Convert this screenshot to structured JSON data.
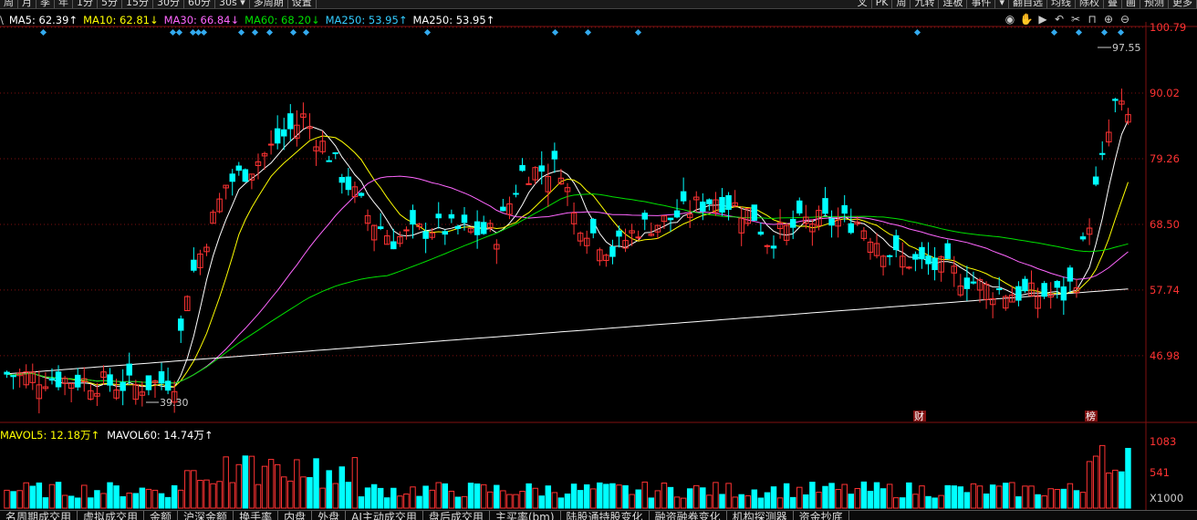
{
  "toolbar": {
    "left_buttons": [
      "周",
      "月",
      "季",
      "年",
      "1分",
      "5分",
      "15分",
      "30分",
      "60分",
      "30s ▾",
      "多周期",
      "设置"
    ],
    "right_buttons": [
      "叉",
      "PK",
      "周",
      "九转",
      "连板",
      "事件",
      "▾",
      "翻自选",
      "均线",
      "除权",
      "叠",
      "画",
      "预测",
      "更多"
    ]
  },
  "legend": {
    "prefix": "\\",
    "items": [
      {
        "text": "MA5: 62.39↑",
        "color": "#ffffff"
      },
      {
        "text": "MA10: 62.81↓",
        "color": "#ffff00"
      },
      {
        "text": "MA30: 66.84↓",
        "color": "#ff66ff"
      },
      {
        "text": "MA60: 68.20↓",
        "color": "#00e000"
      },
      {
        "text": "MA250: 53.95↑",
        "color": "#33ccff"
      },
      {
        "text": "MA250: 53.95↑",
        "color": "#ffffff"
      }
    ]
  },
  "tools": [
    "eye-icon",
    "hand-icon",
    "play-icon",
    "back-icon",
    "scissors-icon",
    "lock-icon",
    "zoom-in-icon",
    "zoom-out-icon"
  ],
  "price_axis": [
    "100.79",
    "90.02",
    "79.26",
    "68.50",
    "57.74",
    "46.98"
  ],
  "annotations": {
    "high": "97.55",
    "low": "39.30",
    "event1": "财",
    "event2": "榜"
  },
  "vol_legend": [
    {
      "text": "MAVOL5: 12.18万↑",
      "color": "#ffff00"
    },
    {
      "text": "MAVOL60: 14.74万↑",
      "color": "#ffffff"
    }
  ],
  "vol_axis": [
    "1083",
    "541",
    "X1000"
  ],
  "bottom_tabs": [
    "名周期成交用",
    "虚拟成交用",
    "金额",
    "沪深金额",
    "换手率",
    "内盘",
    "外盘",
    "AI主动成交用",
    "盘后成交用",
    "主买率(bm)",
    "陆股通持股变化",
    "融资融券变化",
    "机构探测器",
    "资金抄底"
  ],
  "colors": {
    "up": "#ff3333",
    "down": "#00ffff",
    "grid": "#801010",
    "axis_text": "#ff3333"
  }
}
